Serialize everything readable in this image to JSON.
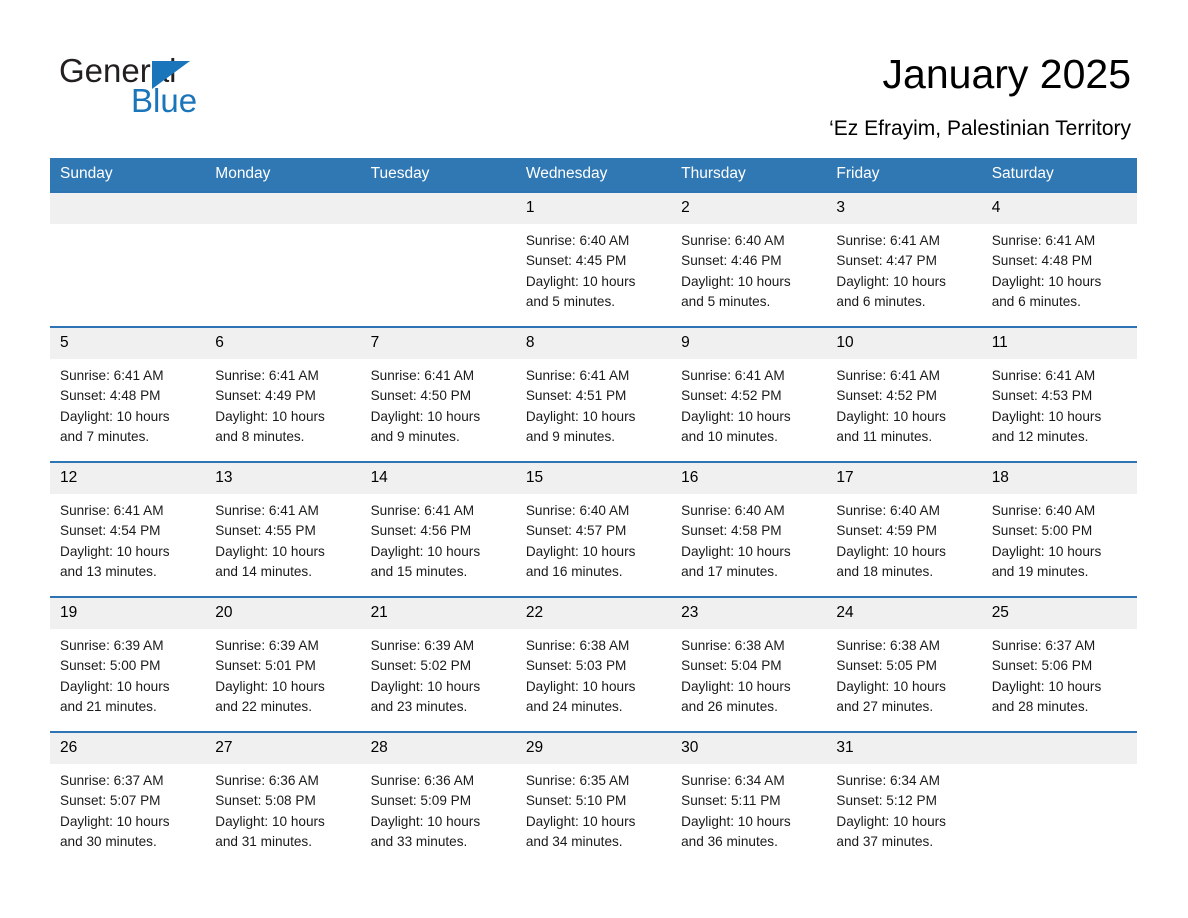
{
  "brand": {
    "word1": "General",
    "word2": "Blue",
    "triangle_color": "#1b75bb",
    "text_color": "#231f20"
  },
  "header": {
    "title": "January 2025",
    "subtitle": "‘Ez Efrayim, Palestinian Territory"
  },
  "calendar": {
    "header_bg": "#3078b4",
    "row_border": "#2e74b5",
    "daynum_bg": "#f0f0f0",
    "weekdays": [
      "Sunday",
      "Monday",
      "Tuesday",
      "Wednesday",
      "Thursday",
      "Friday",
      "Saturday"
    ],
    "weeks": [
      [
        {
          "day": "",
          "empty": true
        },
        {
          "day": "",
          "empty": true
        },
        {
          "day": "",
          "empty": true
        },
        {
          "day": "1",
          "sunrise": "Sunrise: 6:40 AM",
          "sunset": "Sunset: 4:45 PM",
          "daylight1": "Daylight: 10 hours",
          "daylight2": "and 5 minutes."
        },
        {
          "day": "2",
          "sunrise": "Sunrise: 6:40 AM",
          "sunset": "Sunset: 4:46 PM",
          "daylight1": "Daylight: 10 hours",
          "daylight2": "and 5 minutes."
        },
        {
          "day": "3",
          "sunrise": "Sunrise: 6:41 AM",
          "sunset": "Sunset: 4:47 PM",
          "daylight1": "Daylight: 10 hours",
          "daylight2": "and 6 minutes."
        },
        {
          "day": "4",
          "sunrise": "Sunrise: 6:41 AM",
          "sunset": "Sunset: 4:48 PM",
          "daylight1": "Daylight: 10 hours",
          "daylight2": "and 6 minutes."
        }
      ],
      [
        {
          "day": "5",
          "sunrise": "Sunrise: 6:41 AM",
          "sunset": "Sunset: 4:48 PM",
          "daylight1": "Daylight: 10 hours",
          "daylight2": "and 7 minutes."
        },
        {
          "day": "6",
          "sunrise": "Sunrise: 6:41 AM",
          "sunset": "Sunset: 4:49 PM",
          "daylight1": "Daylight: 10 hours",
          "daylight2": "and 8 minutes."
        },
        {
          "day": "7",
          "sunrise": "Sunrise: 6:41 AM",
          "sunset": "Sunset: 4:50 PM",
          "daylight1": "Daylight: 10 hours",
          "daylight2": "and 9 minutes."
        },
        {
          "day": "8",
          "sunrise": "Sunrise: 6:41 AM",
          "sunset": "Sunset: 4:51 PM",
          "daylight1": "Daylight: 10 hours",
          "daylight2": "and 9 minutes."
        },
        {
          "day": "9",
          "sunrise": "Sunrise: 6:41 AM",
          "sunset": "Sunset: 4:52 PM",
          "daylight1": "Daylight: 10 hours",
          "daylight2": "and 10 minutes."
        },
        {
          "day": "10",
          "sunrise": "Sunrise: 6:41 AM",
          "sunset": "Sunset: 4:52 PM",
          "daylight1": "Daylight: 10 hours",
          "daylight2": "and 11 minutes."
        },
        {
          "day": "11",
          "sunrise": "Sunrise: 6:41 AM",
          "sunset": "Sunset: 4:53 PM",
          "daylight1": "Daylight: 10 hours",
          "daylight2": "and 12 minutes."
        }
      ],
      [
        {
          "day": "12",
          "sunrise": "Sunrise: 6:41 AM",
          "sunset": "Sunset: 4:54 PM",
          "daylight1": "Daylight: 10 hours",
          "daylight2": "and 13 minutes."
        },
        {
          "day": "13",
          "sunrise": "Sunrise: 6:41 AM",
          "sunset": "Sunset: 4:55 PM",
          "daylight1": "Daylight: 10 hours",
          "daylight2": "and 14 minutes."
        },
        {
          "day": "14",
          "sunrise": "Sunrise: 6:41 AM",
          "sunset": "Sunset: 4:56 PM",
          "daylight1": "Daylight: 10 hours",
          "daylight2": "and 15 minutes."
        },
        {
          "day": "15",
          "sunrise": "Sunrise: 6:40 AM",
          "sunset": "Sunset: 4:57 PM",
          "daylight1": "Daylight: 10 hours",
          "daylight2": "and 16 minutes."
        },
        {
          "day": "16",
          "sunrise": "Sunrise: 6:40 AM",
          "sunset": "Sunset: 4:58 PM",
          "daylight1": "Daylight: 10 hours",
          "daylight2": "and 17 minutes."
        },
        {
          "day": "17",
          "sunrise": "Sunrise: 6:40 AM",
          "sunset": "Sunset: 4:59 PM",
          "daylight1": "Daylight: 10 hours",
          "daylight2": "and 18 minutes."
        },
        {
          "day": "18",
          "sunrise": "Sunrise: 6:40 AM",
          "sunset": "Sunset: 5:00 PM",
          "daylight1": "Daylight: 10 hours",
          "daylight2": "and 19 minutes."
        }
      ],
      [
        {
          "day": "19",
          "sunrise": "Sunrise: 6:39 AM",
          "sunset": "Sunset: 5:00 PM",
          "daylight1": "Daylight: 10 hours",
          "daylight2": "and 21 minutes."
        },
        {
          "day": "20",
          "sunrise": "Sunrise: 6:39 AM",
          "sunset": "Sunset: 5:01 PM",
          "daylight1": "Daylight: 10 hours",
          "daylight2": "and 22 minutes."
        },
        {
          "day": "21",
          "sunrise": "Sunrise: 6:39 AM",
          "sunset": "Sunset: 5:02 PM",
          "daylight1": "Daylight: 10 hours",
          "daylight2": "and 23 minutes."
        },
        {
          "day": "22",
          "sunrise": "Sunrise: 6:38 AM",
          "sunset": "Sunset: 5:03 PM",
          "daylight1": "Daylight: 10 hours",
          "daylight2": "and 24 minutes."
        },
        {
          "day": "23",
          "sunrise": "Sunrise: 6:38 AM",
          "sunset": "Sunset: 5:04 PM",
          "daylight1": "Daylight: 10 hours",
          "daylight2": "and 26 minutes."
        },
        {
          "day": "24",
          "sunrise": "Sunrise: 6:38 AM",
          "sunset": "Sunset: 5:05 PM",
          "daylight1": "Daylight: 10 hours",
          "daylight2": "and 27 minutes."
        },
        {
          "day": "25",
          "sunrise": "Sunrise: 6:37 AM",
          "sunset": "Sunset: 5:06 PM",
          "daylight1": "Daylight: 10 hours",
          "daylight2": "and 28 minutes."
        }
      ],
      [
        {
          "day": "26",
          "sunrise": "Sunrise: 6:37 AM",
          "sunset": "Sunset: 5:07 PM",
          "daylight1": "Daylight: 10 hours",
          "daylight2": "and 30 minutes."
        },
        {
          "day": "27",
          "sunrise": "Sunrise: 6:36 AM",
          "sunset": "Sunset: 5:08 PM",
          "daylight1": "Daylight: 10 hours",
          "daylight2": "and 31 minutes."
        },
        {
          "day": "28",
          "sunrise": "Sunrise: 6:36 AM",
          "sunset": "Sunset: 5:09 PM",
          "daylight1": "Daylight: 10 hours",
          "daylight2": "and 33 minutes."
        },
        {
          "day": "29",
          "sunrise": "Sunrise: 6:35 AM",
          "sunset": "Sunset: 5:10 PM",
          "daylight1": "Daylight: 10 hours",
          "daylight2": "and 34 minutes."
        },
        {
          "day": "30",
          "sunrise": "Sunrise: 6:34 AM",
          "sunset": "Sunset: 5:11 PM",
          "daylight1": "Daylight: 10 hours",
          "daylight2": "and 36 minutes."
        },
        {
          "day": "31",
          "sunrise": "Sunrise: 6:34 AM",
          "sunset": "Sunset: 5:12 PM",
          "daylight1": "Daylight: 10 hours",
          "daylight2": "and 37 minutes."
        },
        {
          "day": "",
          "empty": true
        }
      ]
    ]
  }
}
